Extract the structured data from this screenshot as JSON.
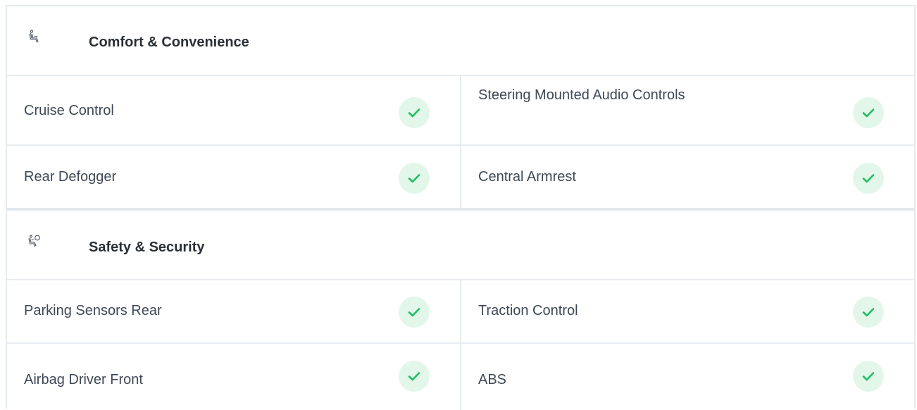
{
  "sections": [
    {
      "icon": "seat-icon",
      "title": "Comfort & Convenience",
      "rows": [
        [
          {
            "label": "Cruise Control",
            "available": true
          },
          {
            "label": "Steering Mounted Audio Controls",
            "available": true
          }
        ],
        [
          {
            "label": "Rear Defogger",
            "available": true
          },
          {
            "label": "Central Armrest",
            "available": true
          }
        ]
      ]
    },
    {
      "icon": "airbag-icon",
      "title": "Safety & Security",
      "rows": [
        [
          {
            "label": "Parking Sensors Rear",
            "available": true
          },
          {
            "label": "Traction Control",
            "available": true
          }
        ],
        [
          {
            "label": "Airbag Driver Front",
            "available": true
          },
          {
            "label": "ABS",
            "available": true
          }
        ]
      ]
    }
  ],
  "colors": {
    "check_bg": "#e3f6ea",
    "check_mark": "#1fbf63",
    "border": "#e5e9ef",
    "title_text": "#2b2f36",
    "label_text": "#3f4856"
  }
}
